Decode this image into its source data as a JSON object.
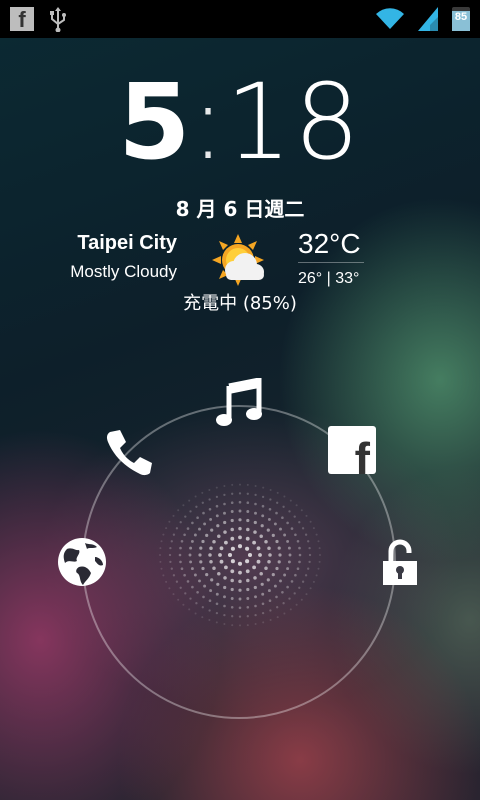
{
  "status_bar": {
    "left_icons": [
      "facebook-notification-icon",
      "usb-icon"
    ],
    "right_icons": [
      "wifi-icon",
      "signal-icon",
      "battery-icon"
    ],
    "facebook_glyph": "f",
    "battery_level": "85"
  },
  "clock": {
    "hour": "5",
    "separator": ":",
    "minute": "18"
  },
  "date": "8 月 6 日週二",
  "weather": {
    "city": "Taipei City",
    "condition": "Mostly Cloudy",
    "temperature": "32°C",
    "range": "26° | 33°",
    "icon": "sun-behind-cloud-icon"
  },
  "charging_text": "充電中 (85%)",
  "unlock_targets": [
    {
      "name": "music-icon"
    },
    {
      "name": "phone-icon"
    },
    {
      "name": "facebook-icon",
      "glyph": "f"
    },
    {
      "name": "browser-globe-icon"
    },
    {
      "name": "unlock-icon"
    }
  ],
  "colors": {
    "status_bar": "#000000",
    "ring": "#ffffff"
  }
}
